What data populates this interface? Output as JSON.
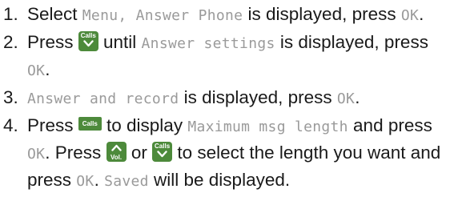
{
  "steps": [
    {
      "num": "1.",
      "parts": [
        "Select ",
        "Menu, Answer Phone",
        " is displayed, press ",
        "OK",
        "."
      ]
    },
    {
      "num": "2.",
      "parts": [
        "Press ",
        " until ",
        "Answer settings",
        " is displayed, press ",
        "OK",
        "."
      ]
    },
    {
      "num": "3.",
      "parts": [
        "Answer and record",
        " is displayed, press ",
        "OK",
        "."
      ]
    },
    {
      "num": "4.",
      "parts": [
        "Press ",
        " to display ",
        "Maximum msg length",
        " and press ",
        "OK",
        ". Press ",
        " or ",
        " to select the length you want and press ",
        "OK",
        ". ",
        "Saved",
        " will be displayed."
      ]
    }
  ],
  "keys": {
    "calls": "Calls",
    "vol": "Vol."
  },
  "colors": {
    "key_bg": "#4d8a3b",
    "text": "#1a1a1a",
    "lcd_text": "#9a9a9a"
  },
  "icons": {
    "calls_key": "calls-down-arrow-icon",
    "vol_key": "vol-up-arrow-icon"
  }
}
